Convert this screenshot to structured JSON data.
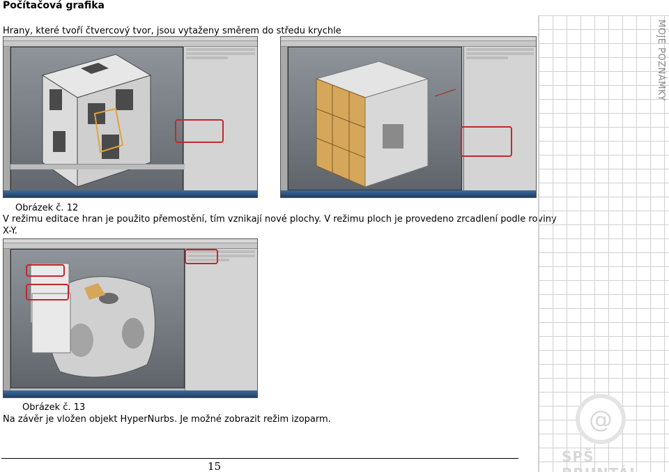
{
  "heading": "Počítačová grafika",
  "intro_text": "Hrany, které tvoří čtvercový tvor, jsou vytaženy směrem do středu krychle",
  "figure12_caption": "Obrázek č. 12",
  "para1_line1": "V režimu editace hran je použito přemostění, tím vznikají nové plochy. V režimu ploch je provedeno zrcadlení podle roviny",
  "para1_line2": "X-Y.",
  "figure13_caption": "Obrázek č. 13",
  "para2": "Na závěr je vložen objekt HyperNurbs. Je možné zobrazit režim izoparm.",
  "page_number": "15",
  "sidebar_label": "MOJE POZNÁMKY",
  "logo_text": "SPŠ BRUNTÁL",
  "colors": {
    "highlight_red": "#c0282d",
    "selection_orange": "#d6a75a",
    "grid_line": "#cfcfcf"
  }
}
